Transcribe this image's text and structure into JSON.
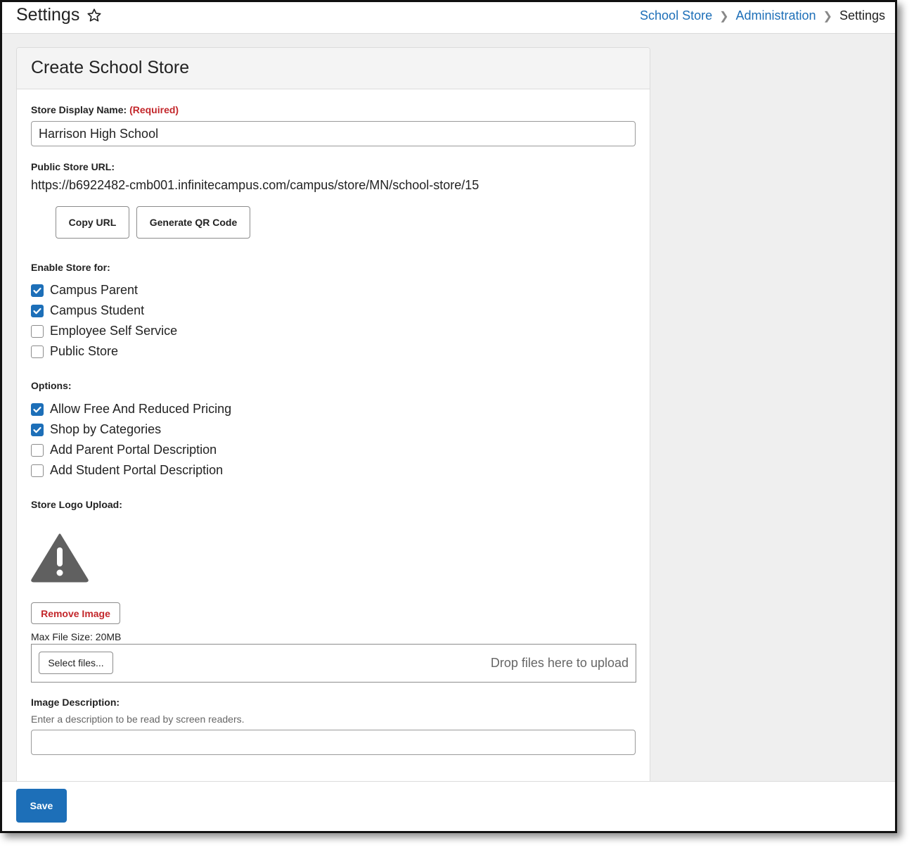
{
  "header": {
    "title": "Settings",
    "breadcrumb": [
      "School Store",
      "Administration",
      "Settings"
    ]
  },
  "form": {
    "title": "Create School Store",
    "display_name_label": "Store Display Name:",
    "required_text": "(Required)",
    "display_name_value": "Harrison High School",
    "url_label": "Public Store URL:",
    "url_value": "https://b6922482-cmb001.infinitecampus.com/campus/store/MN/school-store/15",
    "copy_url_label": "Copy URL",
    "qr_label": "Generate QR Code",
    "enable_label": "Enable Store for:",
    "enable_items": [
      {
        "label": "Campus Parent",
        "checked": true
      },
      {
        "label": "Campus Student",
        "checked": true
      },
      {
        "label": "Employee Self Service",
        "checked": false
      },
      {
        "label": "Public Store",
        "checked": false
      }
    ],
    "options_label": "Options:",
    "options_items": [
      {
        "label": "Allow Free And Reduced Pricing",
        "checked": true
      },
      {
        "label": "Shop by Categories",
        "checked": true
      },
      {
        "label": "Add Parent Portal Description",
        "checked": false
      },
      {
        "label": "Add Student Portal Description",
        "checked": false
      }
    ],
    "logo_label": "Store Logo Upload:",
    "remove_image_label": "Remove Image",
    "max_size_text": "Max File Size: 20MB",
    "select_files_label": "Select files...",
    "drop_text": "Drop files here to upload",
    "image_desc_label": "Image Description:",
    "image_desc_hint": "Enter a description to be read by screen readers.",
    "image_desc_value": ""
  },
  "footer": {
    "save_label": "Save"
  },
  "colors": {
    "accent": "#1d6fb8",
    "required": "#c3272b"
  }
}
